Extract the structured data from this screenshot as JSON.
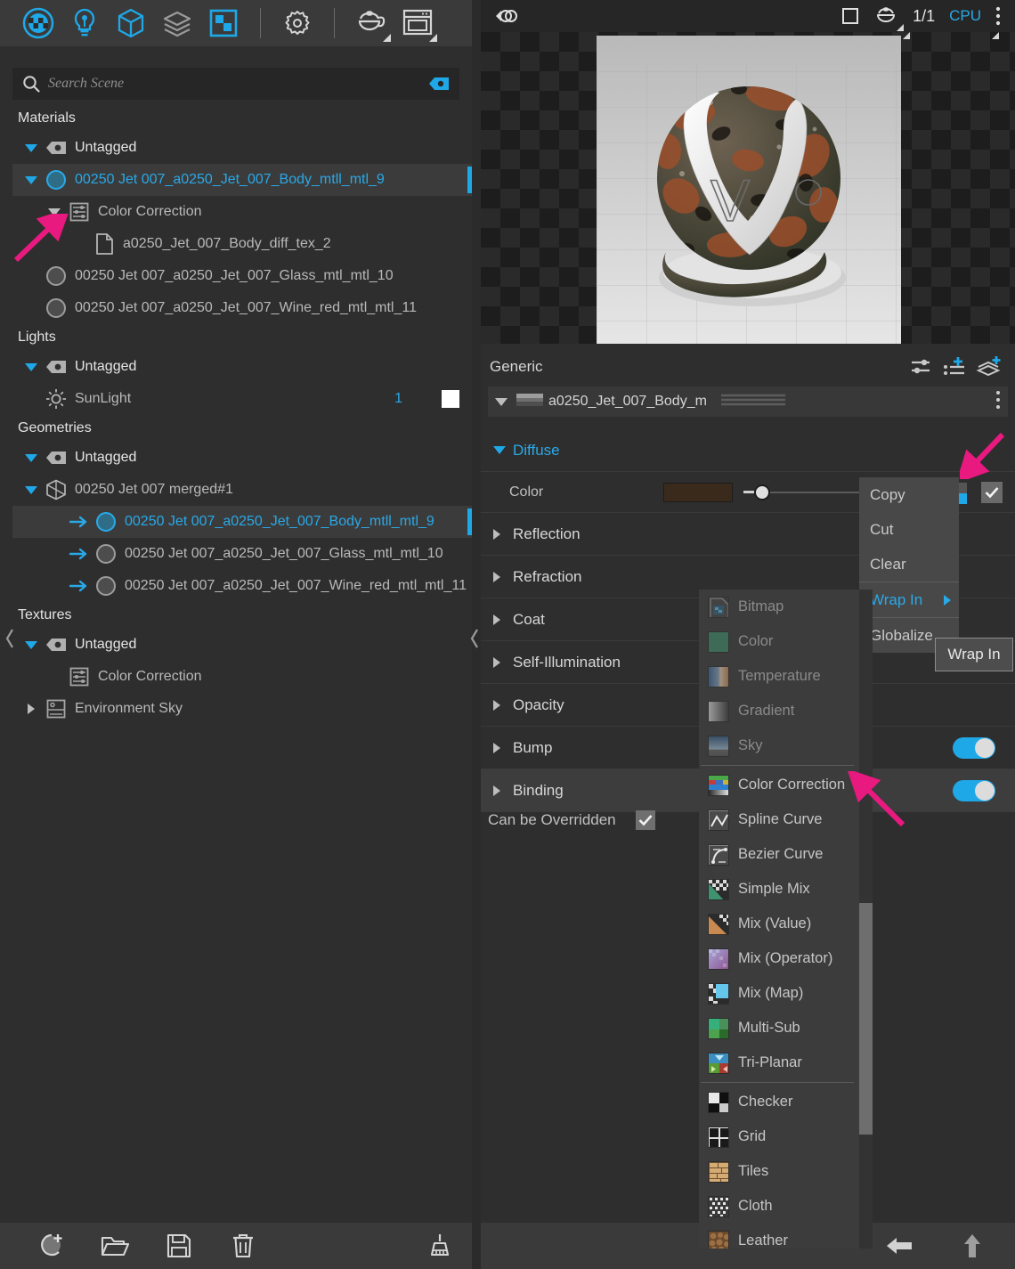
{
  "app": {
    "left_toolbar": [
      {
        "name": "materials-tab-icon",
        "label": "Materials"
      },
      {
        "name": "lights-tab-icon",
        "label": "Lights"
      },
      {
        "name": "geometries-tab-icon",
        "label": "Geometries"
      },
      {
        "name": "layers-tab-icon",
        "label": "Layers"
      },
      {
        "name": "textures-tab-icon",
        "label": "Textures"
      },
      {
        "name": "settings-gear-icon",
        "label": "Settings"
      },
      {
        "name": "teapot-preview-icon",
        "label": "Preview Shape"
      },
      {
        "name": "render-window-icon",
        "label": "Render View"
      }
    ]
  },
  "search": {
    "placeholder": "Search Scene",
    "value": "",
    "icon": "search-icon",
    "clear_icon": "clear-tag-icon"
  },
  "tree": {
    "groups": [
      {
        "title": "Materials",
        "rows": [
          {
            "label": "Untagged",
            "indent": 1,
            "twisty": "down",
            "icon": "tag-icon",
            "style": "white"
          },
          {
            "label": "00250 Jet 007_a0250_Jet_007_Body_mtll_mtl_9",
            "indent": 1,
            "twisty": "down",
            "icon": "material-sphere-blue-icon",
            "style": "blue",
            "selected": true
          },
          {
            "label": "Color Correction",
            "indent": 2,
            "twisty": "down-grey",
            "icon": "color-correction-icon",
            "style": "normal"
          },
          {
            "label": "a0250_Jet_007_Body_diff_tex_2",
            "indent": 3,
            "twisty": "none",
            "icon": "file-icon",
            "style": "normal"
          },
          {
            "label": "00250 Jet 007_a0250_Jet_007_Glass_mtl_mtl_10",
            "indent": 1,
            "twisty": "none",
            "icon": "material-sphere-grey-icon",
            "style": "normal"
          },
          {
            "label": "00250 Jet 007_a0250_Jet_007_Wine_red_mtl_mtl_11",
            "indent": 1,
            "twisty": "none",
            "icon": "material-sphere-grey-icon",
            "style": "normal"
          }
        ]
      },
      {
        "title": "Lights",
        "rows": [
          {
            "label": "Untagged",
            "indent": 1,
            "twisty": "down",
            "icon": "tag-icon",
            "style": "white"
          },
          {
            "label": "SunLight",
            "indent": 1,
            "twisty": "none",
            "icon": "sun-icon",
            "style": "normal",
            "count": "1",
            "swatch": "#ffffff"
          }
        ]
      },
      {
        "title": "Geometries",
        "rows": [
          {
            "label": "Untagged",
            "indent": 1,
            "twisty": "down",
            "icon": "tag-icon",
            "style": "white"
          },
          {
            "label": "00250 Jet 007 merged#1",
            "indent": 1,
            "twisty": "down",
            "icon": "mesh-cube-icon",
            "style": "normal"
          },
          {
            "label": "00250 Jet 007_a0250_Jet_007_Body_mtll_mtl_9",
            "indent": 2,
            "twisty": "none",
            "icon": "link-arrow-icon",
            "icon2": "material-sphere-blue-icon",
            "style": "blue",
            "selected": true
          },
          {
            "label": "00250 Jet 007_a0250_Jet_007_Glass_mtl_mtl_10",
            "indent": 2,
            "twisty": "none",
            "icon": "link-arrow-icon",
            "icon2": "material-sphere-grey-icon",
            "style": "normal"
          },
          {
            "label": "00250 Jet 007_a0250_Jet_007_Wine_red_mtl_mtl_11",
            "indent": 2,
            "twisty": "none",
            "icon": "link-arrow-icon",
            "icon2": "material-sphere-grey-icon",
            "style": "normal"
          }
        ]
      },
      {
        "title": "Textures",
        "rows": [
          {
            "label": "Untagged",
            "indent": 1,
            "twisty": "down",
            "icon": "tag-icon",
            "style": "white"
          },
          {
            "label": "Color Correction",
            "indent": 2,
            "twisty": "none",
            "icon": "color-correction-icon",
            "style": "normal"
          },
          {
            "label": "Environment Sky",
            "indent": 1,
            "twisty": "right",
            "icon": "sky-icon",
            "style": "normal"
          }
        ]
      }
    ]
  },
  "left_bottom_toolbar": [
    {
      "name": "add-material-icon",
      "label": "Add Material"
    },
    {
      "name": "open-folder-icon",
      "label": "Open"
    },
    {
      "name": "save-icon",
      "label": "Save"
    },
    {
      "name": "delete-trash-icon",
      "label": "Delete"
    },
    {
      "name": "purge-broom-icon",
      "label": "Purge"
    }
  ],
  "viewport": {
    "left_icon": "render-mode-icon",
    "right_icons": [
      {
        "name": "square-shape-icon",
        "label": "Cube"
      },
      {
        "name": "teapot-shape-icon",
        "label": "Teapot"
      },
      {
        "name": "resolution-ratio-label",
        "label": "1/1"
      },
      {
        "name": "cpu-device-label",
        "label": "CPU"
      },
      {
        "name": "more-options-icon",
        "label": "More"
      }
    ]
  },
  "properties": {
    "header_title": "Generic",
    "header_icons": [
      {
        "name": "material-settings-icon",
        "label": "Settings"
      },
      {
        "name": "add-parameter-icon",
        "label": "Add Parameter"
      },
      {
        "name": "add-layer-icon",
        "label": "Add Layer"
      }
    ],
    "material_row": {
      "name": "a0250_Jet_007_Body_m",
      "twisty": "down",
      "swatch_icon": "material-strip-icon",
      "bars_icon": "preset-bars-icon",
      "menu_icon": "vertical-dots-icon"
    },
    "sections": [
      {
        "label": "Diffuse",
        "expanded": true,
        "highlight": false
      },
      {
        "label": "Reflection",
        "expanded": false,
        "highlight": false
      },
      {
        "label": "Refraction",
        "expanded": false,
        "highlight": false
      },
      {
        "label": "Coat",
        "expanded": false,
        "highlight": false
      },
      {
        "label": "Self-Illumination",
        "expanded": false,
        "highlight": false
      },
      {
        "label": "Opacity",
        "expanded": false,
        "highlight": false
      },
      {
        "label": "Bump",
        "expanded": false,
        "highlight": false,
        "toggle": true
      },
      {
        "label": "Binding",
        "expanded": false,
        "highlight": true,
        "toggle": true
      }
    ],
    "diffuse": {
      "color_label": "Color",
      "color_value": "#3a2a1c",
      "slider_value": 7,
      "map_icon": "map-slot-icon",
      "checkbox_checked": true
    },
    "override": {
      "label": "Can be Overridden",
      "checked": true
    }
  },
  "right_bottom_toolbar": [
    {
      "name": "back-arrow-icon",
      "label": "Back"
    },
    {
      "name": "up-arrow-icon",
      "label": "Up"
    }
  ],
  "context_menu": {
    "items": [
      {
        "label": "Copy",
        "active": false,
        "submenu": false
      },
      {
        "label": "Cut",
        "active": false,
        "submenu": false
      },
      {
        "label": "Clear",
        "active": false,
        "submenu": false
      },
      {
        "label": "Wrap In",
        "active": true,
        "submenu": true
      },
      {
        "label": "Globalize",
        "active": false,
        "submenu": false
      }
    ],
    "tooltip": "Wrap In"
  },
  "submenu": {
    "items": [
      {
        "label": "Bitmap",
        "icon": "bitmap-icon",
        "disabled": true
      },
      {
        "label": "Color",
        "icon": "color-swatch-icon",
        "disabled": true
      },
      {
        "label": "Temperature",
        "icon": "temperature-icon",
        "disabled": true
      },
      {
        "label": "Gradient",
        "icon": "gradient-icon",
        "disabled": true
      },
      {
        "label": "Sky",
        "icon": "sky-icon",
        "disabled": true
      },
      {
        "separator": true
      },
      {
        "label": "Color Correction",
        "icon": "color-correction-icon",
        "disabled": false
      },
      {
        "label": "Spline Curve",
        "icon": "spline-curve-icon",
        "disabled": false
      },
      {
        "label": "Bezier Curve",
        "icon": "bezier-curve-icon",
        "disabled": false
      },
      {
        "label": "Simple Mix",
        "icon": "simple-mix-icon",
        "disabled": false
      },
      {
        "label": "Mix (Value)",
        "icon": "mix-value-icon",
        "disabled": false
      },
      {
        "label": "Mix (Operator)",
        "icon": "mix-operator-icon",
        "disabled": false
      },
      {
        "label": "Mix (Map)",
        "icon": "mix-map-icon",
        "disabled": false
      },
      {
        "label": "Multi-Sub",
        "icon": "multi-sub-icon",
        "disabled": false
      },
      {
        "label": "Tri-Planar",
        "icon": "tri-planar-icon",
        "disabled": false
      },
      {
        "separator": true
      },
      {
        "label": "Checker",
        "icon": "checker-icon",
        "disabled": false
      },
      {
        "label": "Grid",
        "icon": "grid-icon",
        "disabled": false
      },
      {
        "label": "Tiles",
        "icon": "tiles-icon",
        "disabled": false
      },
      {
        "label": "Cloth",
        "icon": "cloth-icon",
        "disabled": false
      },
      {
        "label": "Leather",
        "icon": "leather-icon",
        "disabled": false
      }
    ]
  },
  "colors": {
    "accent": "#1fa8e8",
    "annotation": "#e8197f",
    "panel_bg": "#2e2e2e",
    "toolbar_bg": "#3a3a3a"
  }
}
